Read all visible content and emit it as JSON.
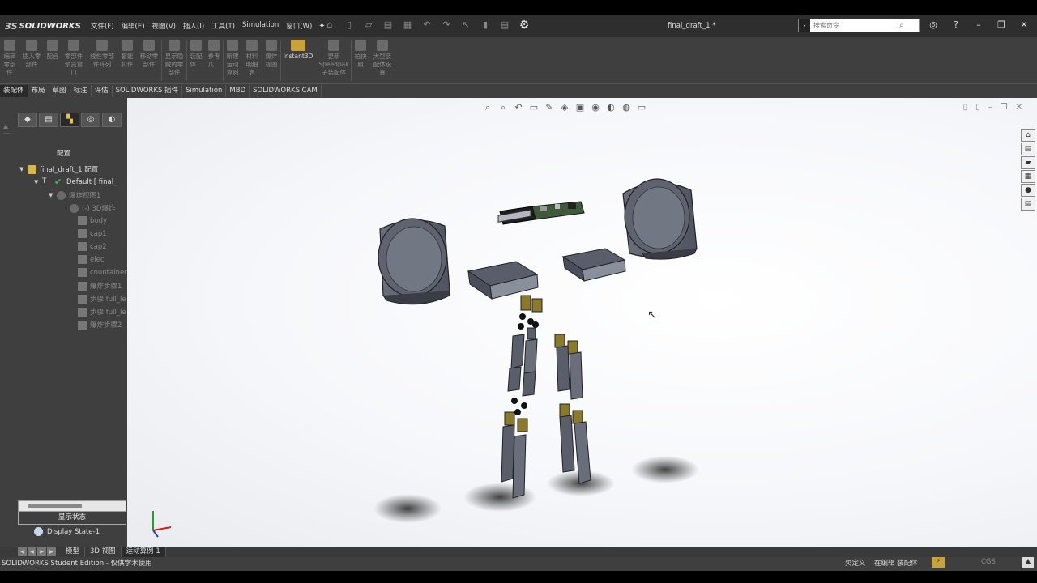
{
  "app": {
    "logo": "SOLIDWORKS",
    "menus": [
      "文件(F)",
      "编辑(E)",
      "视图(V)",
      "插入(I)",
      "工具(T)",
      "Simulation",
      "窗口(W)"
    ],
    "document_title": "final_draft_1 *",
    "search_placeholder": "搜索命令"
  },
  "ribbon": [
    {
      "label": "编辑\n零部\n件"
    },
    {
      "label": "插入零\n部件"
    },
    {
      "label": "配合"
    },
    {
      "label": "零部件\n预览窗\n口"
    },
    {
      "label": "线性零部\n件阵列"
    },
    {
      "label": "智能\n扣件"
    },
    {
      "label": "移动零\n部件"
    },
    {
      "label": "显示隐\n藏的零\n部件"
    },
    {
      "label": "装配\n体..."
    },
    {
      "label": "参考\n几..."
    },
    {
      "label": "新建\n运动\n算例"
    },
    {
      "label": "材料\n明细\n表"
    },
    {
      "label": "爆炸\n视图"
    },
    {
      "label": "Instant3D"
    },
    {
      "label": "更新\nSpeedpak\n子装配体"
    },
    {
      "label": "拍快\n照"
    },
    {
      "label": "大型装\n配体设\n置"
    }
  ],
  "tabs": [
    "装配体",
    "布局",
    "草图",
    "标注",
    "评估",
    "SOLIDWORKS 插件",
    "Simulation",
    "MBD",
    "SOLIDWORKS CAM"
  ],
  "left_pane": {
    "title": "配置",
    "tree": [
      {
        "label": "final_draft_1 配置"
      },
      {
        "label": "Default [ final_"
      },
      {
        "label": "爆炸视图1"
      },
      {
        "label": "(-) 3D爆炸"
      },
      {
        "label": "body"
      },
      {
        "label": "cap1"
      },
      {
        "label": "cap2"
      },
      {
        "label": "elec"
      },
      {
        "label": "countainer"
      },
      {
        "label": "爆炸步骤1"
      },
      {
        "label": "步骤 full_le"
      },
      {
        "label": "步骤 full_le"
      },
      {
        "label": "爆炸步骤2"
      }
    ],
    "display_state_title": "显示状态",
    "display_state": "Display State-1"
  },
  "bottom_tabs": [
    "模型",
    "3D 视图",
    "运动算例 1"
  ],
  "status": {
    "edition": "SOLIDWORKS Student Edition - 仅供学术使用",
    "defined": "欠定义",
    "editing": "在编辑 装配体",
    "units": "CGS"
  },
  "colors": {
    "ui_background": "#3f3f3f",
    "part_gray": "#5a5e6b",
    "servo_yellow": "#8a7a2a",
    "pcb_green": "#3e5a3a"
  }
}
